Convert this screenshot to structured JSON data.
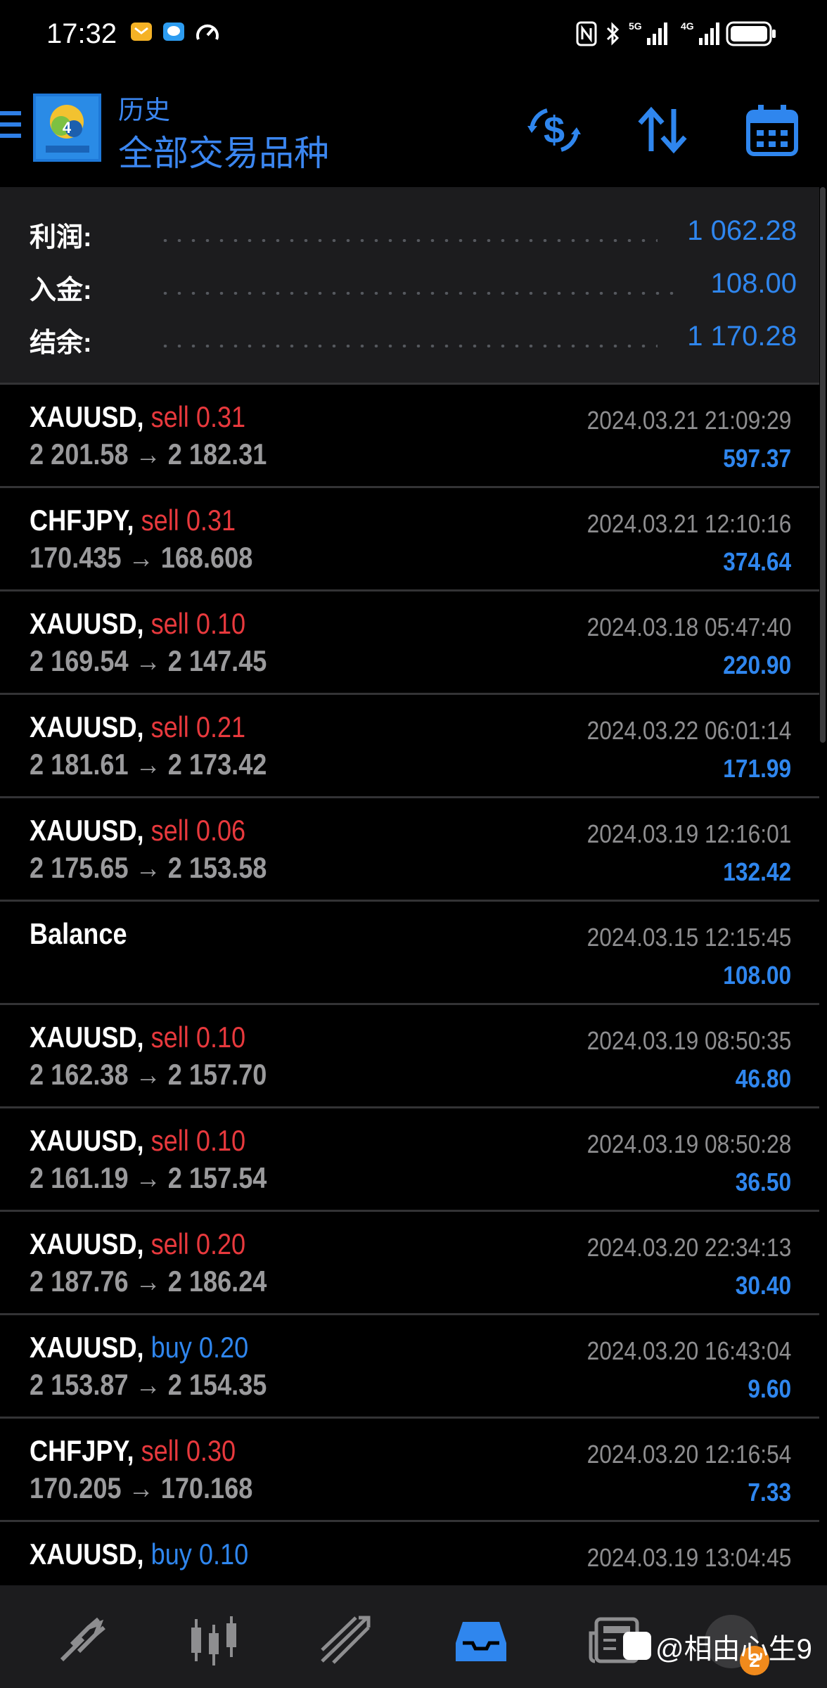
{
  "status_bar": {
    "time": "17:32",
    "right_icons": [
      "nfc-icon",
      "bluetooth-icon",
      "5g-signal-icon",
      "4g-signal-icon",
      "battery-icon"
    ],
    "left_icons": [
      "mail-notification-icon",
      "chat-notification-icon",
      "speed-icon"
    ]
  },
  "header": {
    "subtitle": "历史",
    "title": "全部交易品种",
    "buttons": [
      "currency-exchange-icon",
      "sort-icon",
      "calendar-icon"
    ]
  },
  "summary": {
    "items": [
      {
        "label": "利润:",
        "value": "1 062.28"
      },
      {
        "label": "入金:",
        "value": "108.00"
      },
      {
        "label": "结余:",
        "value": "1 170.28"
      }
    ]
  },
  "deals": [
    {
      "symbol": "XAUUSD,",
      "side": "sell",
      "volume": "0.31",
      "prices": "2 201.58 → 2 182.31",
      "date": "2024.03.21 21:09:29",
      "profit": "597.37"
    },
    {
      "symbol": "CHFJPY,",
      "side": "sell",
      "volume": "0.31",
      "prices": "170.435 → 168.608",
      "date": "2024.03.21 12:10:16",
      "profit": "374.64"
    },
    {
      "symbol": "XAUUSD,",
      "side": "sell",
      "volume": "0.10",
      "prices": "2 169.54 → 2 147.45",
      "date": "2024.03.18 05:47:40",
      "profit": "220.90"
    },
    {
      "symbol": "XAUUSD,",
      "side": "sell",
      "volume": "0.21",
      "prices": "2 181.61 → 2 173.42",
      "date": "2024.03.22 06:01:14",
      "profit": "171.99"
    },
    {
      "symbol": "XAUUSD,",
      "side": "sell",
      "volume": "0.06",
      "prices": "2 175.65 → 2 153.58",
      "date": "2024.03.19 12:16:01",
      "profit": "132.42"
    },
    {
      "symbol": "Balance",
      "side": "",
      "volume": "",
      "prices": "",
      "date": "2024.03.15 12:15:45",
      "profit": "108.00"
    },
    {
      "symbol": "XAUUSD,",
      "side": "sell",
      "volume": "0.10",
      "prices": "2 162.38 → 2 157.70",
      "date": "2024.03.19 08:50:35",
      "profit": "46.80"
    },
    {
      "symbol": "XAUUSD,",
      "side": "sell",
      "volume": "0.10",
      "prices": "2 161.19 → 2 157.54",
      "date": "2024.03.19 08:50:28",
      "profit": "36.50"
    },
    {
      "symbol": "XAUUSD,",
      "side": "sell",
      "volume": "0.20",
      "prices": "2 187.76 → 2 186.24",
      "date": "2024.03.20 22:34:13",
      "profit": "30.40"
    },
    {
      "symbol": "XAUUSD,",
      "side": "buy",
      "volume": "0.20",
      "prices": "2 153.87 → 2 154.35",
      "date": "2024.03.20 16:43:04",
      "profit": "9.60"
    },
    {
      "symbol": "CHFJPY,",
      "side": "sell",
      "volume": "0.30",
      "prices": "170.205 → 170.168",
      "date": "2024.03.20 12:16:54",
      "profit": "7.33"
    },
    {
      "symbol": "XAUUSD,",
      "side": "buy",
      "volume": "0.10",
      "prices": "",
      "date": "2024.03.19 13:04:45",
      "profit": ""
    }
  ],
  "bottom_nav": {
    "items": [
      "quotes-icon",
      "chart-icon",
      "trade-icon",
      "history-icon",
      "news-icon"
    ],
    "active": "history-icon"
  },
  "watermark": {
    "text": "@相由心生9",
    "badge": "2"
  },
  "colors": {
    "accent": "#2f86ee",
    "sell": "#e8393d",
    "background": "#000000",
    "panel": "#1c1c1e"
  }
}
